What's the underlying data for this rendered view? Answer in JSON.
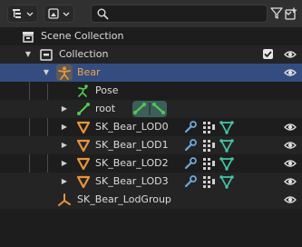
{
  "header": {
    "display_mode_icon": "outliner-display-mode-icon",
    "view_icon": "image-view-icon",
    "search": {
      "value": "",
      "placeholder": ""
    },
    "filter_icon": "filter-funnel-icon",
    "new_collection_icon": "new-collection-icon"
  },
  "tree": {
    "scene_collection": "Scene Collection",
    "collection": "Collection",
    "bear": "Bear",
    "pose": "Pose",
    "root": "root",
    "lods": [
      "SK_Bear_LOD0",
      "SK_Bear_LOD1",
      "SK_Bear_LOD2",
      "SK_Bear_LOD3"
    ],
    "lod_group": "SK_Bear_LodGroup"
  },
  "colors": {
    "selected_row": "#334d80",
    "object_orange": "#e8943a",
    "data_teal": "#46c4a9",
    "modifier_blue": "#6ea7d8",
    "bone_green": "#51c751"
  }
}
